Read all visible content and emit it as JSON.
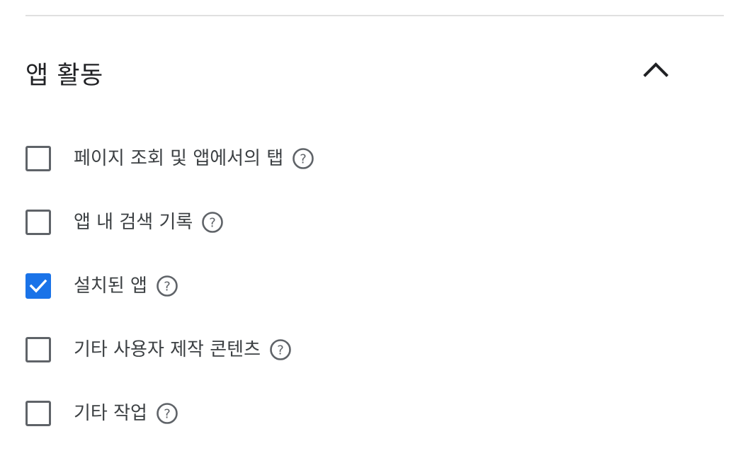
{
  "section": {
    "title": "앱 활동",
    "collapse_icon": "chevron-up-icon",
    "expanded": true
  },
  "options": [
    {
      "label": "페이지 조회 및 앱에서의 탭",
      "checked": false,
      "help_icon": "help-icon"
    },
    {
      "label": "앱 내 검색 기록",
      "checked": false,
      "help_icon": "help-icon"
    },
    {
      "label": "설치된 앱",
      "checked": true,
      "help_icon": "help-icon"
    },
    {
      "label": "기타 사용자 제작 콘텐츠",
      "checked": false,
      "help_icon": "help-icon"
    },
    {
      "label": "기타 작업",
      "checked": false,
      "help_icon": "help-icon"
    }
  ],
  "colors": {
    "accent": "#1a73e8",
    "checkbox_border": "#5f6368",
    "divider": "#e0e0e0",
    "text": "#202124"
  }
}
